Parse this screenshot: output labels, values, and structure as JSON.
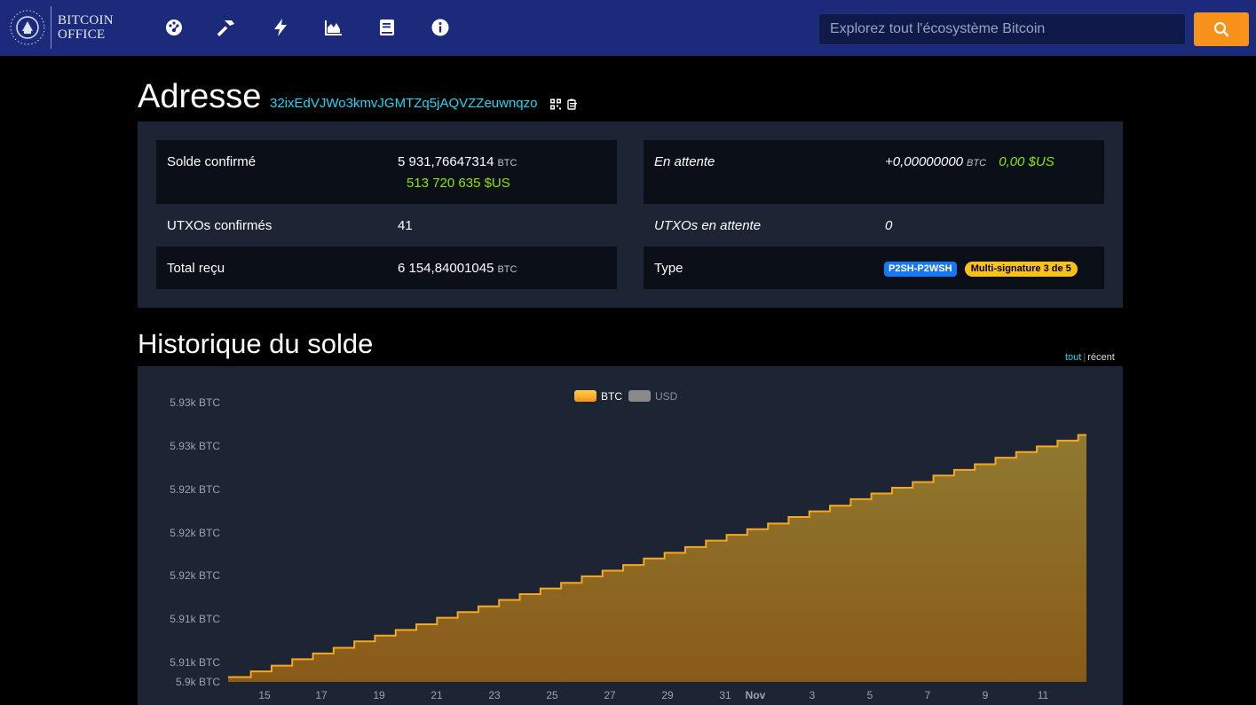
{
  "header": {
    "logo_line1": "BITCOIN",
    "logo_line2": "OFFICE",
    "nav_icons": [
      "dashboard-icon",
      "hammer-icon",
      "lightning-icon",
      "chart-area-icon",
      "book-icon",
      "info-icon"
    ],
    "search_placeholder": "Explorez tout l'écosystème Bitcoin",
    "search_button_icon": "search-icon"
  },
  "colors": {
    "header_bg": "#1b2a7a",
    "accent": "#f7931a",
    "address": "#1bd8f4",
    "usd_green": "#8ce600",
    "panel_bg": "#1d2433"
  },
  "title": "Adresse",
  "address": "32ixEdVJWo3kmvJGMTZq5jAQVZZeuwnqzo",
  "summary": {
    "confirmed_balance_label": "Solde confirmé",
    "confirmed_balance_btc": "5 931,76647314",
    "confirmed_balance_unit": "BTC",
    "confirmed_balance_usd": "513 720 635 $US",
    "utxos_confirmed_label": "UTXOs confirmés",
    "utxos_confirmed_value": "41",
    "total_received_label": "Total reçu",
    "total_received_btc": "6 154,84001045",
    "total_received_unit": "BTC",
    "pending_label": "En attente",
    "pending_btc": "+0,00000000",
    "pending_unit": "BTC",
    "pending_usd": "0,00 $US",
    "utxos_pending_label": "UTXOs en attente",
    "utxos_pending_value": "0",
    "type_label": "Type",
    "type_badge": "P2SH-P2WSH",
    "multisig_badge": "Multi-signature 3 de 5"
  },
  "history": {
    "title": "Historique du solde",
    "range_all": "tout",
    "range_recent": "récent"
  },
  "chart_data": {
    "type": "area",
    "legend": [
      "BTC",
      "USD"
    ],
    "legend_placement": "top-center",
    "series": [
      {
        "name": "BTC",
        "values": [
          5899.6,
          5900.3,
          5901.0,
          5901.8,
          5902.5,
          5903.2,
          5904.0,
          5904.7,
          5905.4,
          5906.1,
          5906.9,
          5907.6,
          5908.3,
          5909.1,
          5909.8,
          5910.5,
          5911.2,
          5912.0,
          5912.7,
          5913.4,
          5914.2,
          5914.9,
          5915.6,
          5916.4,
          5917.1,
          5917.8,
          5918.5,
          5919.3,
          5920.0,
          5920.7,
          5921.5,
          5922.2,
          5922.9,
          5923.6,
          5924.4,
          5925.1,
          5925.8,
          5926.6,
          5927.3,
          5928.0,
          5928.7,
          5929.4
        ]
      }
    ],
    "y_tick_labels": [
      "5.93k BTC",
      "5.93k BTC",
      "5.92k BTC",
      "5.92k BTC",
      "5.92k BTC",
      "5.91k BTC",
      "5.91k BTC",
      "5.9k BTC"
    ],
    "x_tick_labels": [
      "15",
      "17",
      "19",
      "21",
      "23",
      "25",
      "27",
      "29",
      "31",
      "Nov",
      "3",
      "5",
      "7",
      "9",
      "11"
    ],
    "ylim": [
      5899.0,
      5930.0
    ]
  }
}
